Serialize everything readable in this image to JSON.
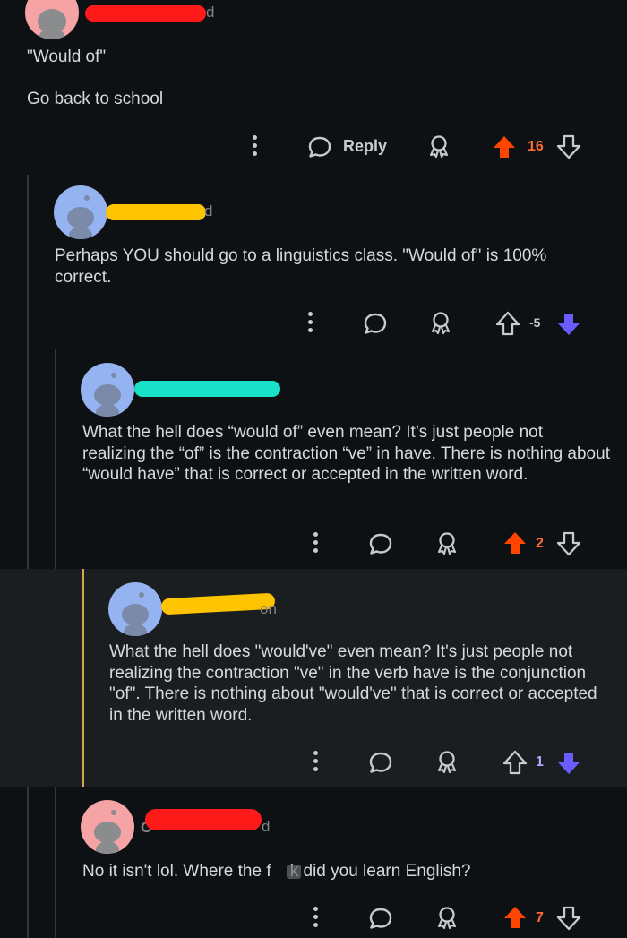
{
  "comments": [
    {
      "quote": "\"Would of\"",
      "body": "Go back to school",
      "username_tail": "d",
      "reply_label": "Reply",
      "votes": "16",
      "vote_state": "up"
    },
    {
      "body": "Perhaps YOU should go to a linguistics class. \"Would of\" is 100% correct.",
      "username_tail": "d",
      "votes": "-5",
      "vote_state": "down"
    },
    {
      "body": "What the hell does “would of” even mean? It’s just people not realizing the “of” is the contraction “ve” in have. There is nothing about “would have” that is correct or accepted in the written word.",
      "username_tail": "",
      "votes": "2",
      "vote_state": "up"
    },
    {
      "body": "What the hell does \"would've\" even mean? It's just people not realizing the contraction \"ve\" in the verb have is the conjunction \"of\". There is nothing about \"would've\" that is correct or accepted in the written word.",
      "username_tail": "on",
      "votes": "1",
      "vote_state": "down"
    },
    {
      "body": "No it isn't lol. Where the f  k did you learn English?",
      "username_tail": "d",
      "username_prefix": "C",
      "votes": "7",
      "vote_state": "up"
    }
  ],
  "colors": {
    "upvote": "#ff4500",
    "downvote": "#6a5cff",
    "redact_red": "#ff1a1a",
    "redact_yellow": "#ffc400",
    "redact_cyan": "#19e0c8",
    "highlight_bar": "#d6a64a",
    "avatar_pink": "#f5a3a5",
    "avatar_blue": "#94b3f0"
  }
}
